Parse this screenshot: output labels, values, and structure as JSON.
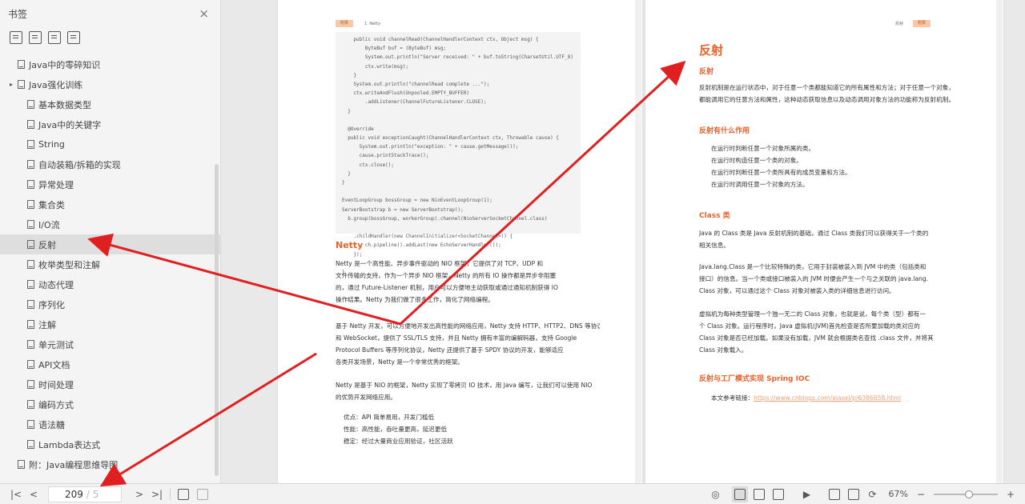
{
  "sidebar": {
    "title": "书签",
    "close_icon": "×",
    "tool_icons": [
      "expand-all-icon",
      "collapse-all-icon",
      "add-bookmark-icon",
      "delete-bookmark-icon"
    ],
    "bookmarks": [
      {
        "label": "Java中的零碎知识",
        "level": 0,
        "expandable": false
      },
      {
        "label": "Java强化训练",
        "level": 0,
        "expandable": true
      },
      {
        "label": "基本数据类型",
        "level": 1
      },
      {
        "label": "Java中的关键字",
        "level": 1
      },
      {
        "label": "String",
        "level": 1
      },
      {
        "label": "自动装箱/拆箱的实现",
        "level": 1
      },
      {
        "label": "异常处理",
        "level": 1
      },
      {
        "label": "集合类",
        "level": 1
      },
      {
        "label": "I/O流",
        "level": 1
      },
      {
        "label": "反射",
        "level": 1,
        "active": true
      },
      {
        "label": "枚举类型和注解",
        "level": 1
      },
      {
        "label": "动态代理",
        "level": 1
      },
      {
        "label": "序列化",
        "level": 1
      },
      {
        "label": "注解",
        "level": 1
      },
      {
        "label": "单元测试",
        "level": 1
      },
      {
        "label": "API文档",
        "level": 1
      },
      {
        "label": "时间处理",
        "level": 1
      },
      {
        "label": "编码方式",
        "level": 1
      },
      {
        "label": "语法糖",
        "level": 1
      },
      {
        "label": "Lambda表达式",
        "level": 1
      },
      {
        "label": "附：Java编程思维导图",
        "level": 0,
        "expandable": false
      }
    ]
  },
  "left_page": {
    "header_tag": "附录",
    "header_text": "1. Netty",
    "code_lines": [
      "    public void channelRead(ChannelHandlerContext ctx, Object msg) {",
      "        ByteBuf buf = (ByteBuf) msg;",
      "        System.out.println(\"Server received: \" + buf.toString(CharsetUtil.UTF_8));",
      "        ctx.write(msg);",
      "    }",
      "    System.out.println(\"channelRead complete ...\");",
      "    ctx.writeAndFlush(Unpooled.EMPTY_BUFFER)",
      "        .addListener(ChannelFutureListener.CLOSE);",
      "  }",
      "",
      "  @Override",
      "  public void exceptionCaught(ChannelHandlerContext ctx, Throwable cause) {",
      "      System.out.println(\"exception: \" + cause.getMessage());",
      "      cause.printStackTrace();",
      "      ctx.close();",
      "  }",
      "}",
      "",
      "EventLoopGroup bossGroup = new NioEventLoopGroup(1);",
      "ServerBootstrap b = new ServerBootstrap();",
      "  b.group(bossGroup, workerGroup).channel(NioServerSocketChannel.class)",
      "",
      "    .childHandler(new ChannelInitializer<SocketChannel>() {",
      "        ch.pipeline().addLast(new EchoServerHandler());",
      "    });",
      "",
      "}"
    ],
    "section_heading": "Netty",
    "paragraphs": [
      [
        "Netty 是一个高性能、异步事件驱动的 NIO 框架，它提供了对 TCP、UDP 和",
        "文件传输的支持，作为一个异步 NIO 框架，Netty 的所有 IO 操作都是异步非阻塞",
        "的，通过 Future-Listener 机制，用户可以方便地主动获取或通过通知机制获得 IO",
        "操作结果。Netty 为我们做了很多工作，简化了网络编程。"
      ],
      [
        "基于 Netty 开发，可以方便地开发出高性能的网络应用，Netty 支持 HTTP、HTTP2、DNS 等协议",
        "和 WebSocket，提供了 SSL/TLS 支持，并且 Netty 拥有丰富的编解码器，支持 Google",
        "Protocol Buffers 等序列化协议，Netty 还提供了基于 SPDY 协议的开发，能够适应",
        "各类开发场景，Netty 是一个非常优秀的框架。"
      ],
      [
        "Netty 是基于 NIO 的框架，Netty 实现了零拷贝 IO 技术，用 Java 编写，让我们可以使用 NIO",
        "的优势开发网络应用。"
      ]
    ],
    "list_items": [
      "优点：API 简单易用，开发门槛低",
      "性能：高性能，吞吐量更高，延迟更低",
      "稳定：经过大量商业应用验证，社区活跃"
    ]
  },
  "right_page": {
    "header_text": "反射",
    "header_tag": "附录",
    "title": "反射",
    "subtitle": "反射",
    "intro": [
      "反射机制是在运行状态中，对于任意一个类都能知道它的所有属性和方法；对于任意一个对象，",
      "都能调用它的任意方法和属性，这种动态获取信息以及动态调用对象方法的功能称为反射机制。"
    ],
    "h2_1": "反射有什么作用",
    "uses": [
      "在运行时判断任意一个对象所属的类。",
      "在运行时构造任意一个类的对象。",
      "在运行时判断任意一个类所具有的成员变量和方法。",
      "在运行时调用任意一个对象的方法。"
    ],
    "h2_2": "Class 类",
    "class_p1": [
      "Java 的 Class 类是 Java 反射机制的基础，通过 Class 类我们可以获得关于一个类的",
      "相关信息。"
    ],
    "class_p2": [
      "Java.lang.Class 是一个比较特殊的类，它用于封装被装入到 JVM 中的类（包括类和",
      "接口）的信息。当一个类或接口被装入的 JVM 时便会产生一个与之关联的 java.lang.",
      "Class 对象，可以通过这个 Class 对象对被装入类的详细信息进行访问。"
    ],
    "class_p3": [
      "虚拟机为每种类型管理一个独一无二的 Class 对象，也就是说，每个类（型）都有一",
      "个 Class 对象。运行程序时，Java 虚拟机(JVM)首先检查是否所要加载的类对应的",
      "Class 对象是否已经加载。如果没有加载，JVM 就会根据类名查找 .class 文件，并将其",
      "Class 对象载入。"
    ],
    "h2_3": "反射与工厂模式实现 Spring IOC",
    "ioc_label": "本文参考链接：",
    "ioc_link": "https://www.cnblogs.com/xiaoxi/p/6386658.html"
  },
  "toolbar": {
    "first_page": "|<",
    "prev_page": "<",
    "current_page": "209",
    "total_pages": "/ 5",
    "next_page": ">",
    "last_page": ">|",
    "zoom_text": "67%",
    "zoom_minus": "−",
    "zoom_plus": "+",
    "zoom_level": 0.55
  },
  "colors": {
    "accent_orange": "#e8622a",
    "arrow_red": "#e02020"
  }
}
